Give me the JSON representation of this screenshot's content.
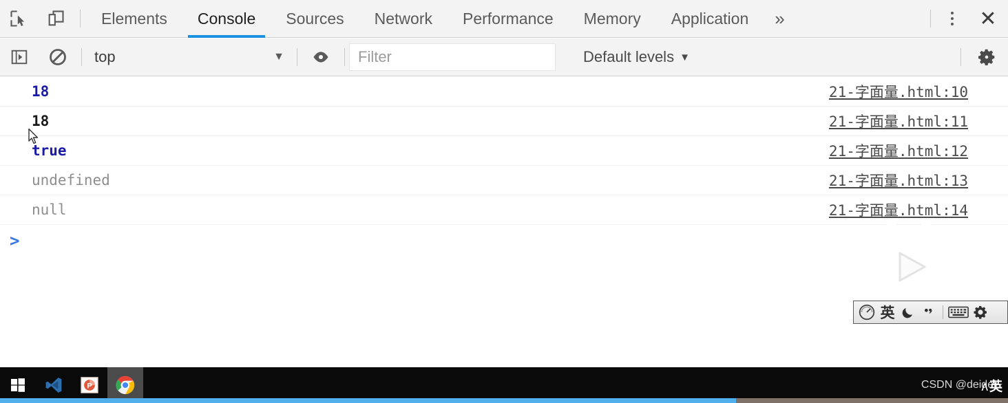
{
  "window": {
    "app": "Chrome DevTools"
  },
  "tabbar": {
    "icons": [
      {
        "name": "inspect-element-icon",
        "label": "Inspect element"
      },
      {
        "name": "device-toolbar-icon",
        "label": "Toggle device toolbar"
      }
    ],
    "tabs": [
      {
        "label": "Elements",
        "active": false
      },
      {
        "label": "Console",
        "active": true
      },
      {
        "label": "Sources",
        "active": false
      },
      {
        "label": "Network",
        "active": false
      },
      {
        "label": "Performance",
        "active": false
      },
      {
        "label": "Memory",
        "active": false
      },
      {
        "label": "Application",
        "active": false
      }
    ],
    "more_label": "»",
    "menu_label": "Customize and control DevTools",
    "close_label": "✕",
    "active_underline_color": "#1a90e0"
  },
  "filterbar": {
    "sidebar_toggle_label": "Show console sidebar",
    "clear_label": "Clear console",
    "context": "top",
    "context_caret": "▼",
    "eye_label": "Create live expression",
    "filter_value": "",
    "filter_placeholder": "Filter",
    "levels_label": "Default levels",
    "levels_caret": "▼",
    "settings_label": "Console settings"
  },
  "console": {
    "messages": [
      {
        "text": "18",
        "type": "number",
        "source": "21-字面量.html:10"
      },
      {
        "text": "18",
        "type": "string",
        "source": "21-字面量.html:11"
      },
      {
        "text": "true",
        "type": "boolean",
        "source": "21-字面量.html:12"
      },
      {
        "text": "undefined",
        "type": "undefined",
        "source": "21-字面量.html:13"
      },
      {
        "text": "null",
        "type": "null",
        "source": "21-字面量.html:14"
      }
    ],
    "prompt_caret": ">",
    "prompt_value": ""
  },
  "watermarks": {
    "bilibili_label": "bilibili-logo",
    "csdn_text": "CSDN @deidei~"
  },
  "ime": {
    "items": [
      {
        "name": "sogou-logo-icon",
        "glyph": ""
      },
      {
        "name": "language-mode",
        "glyph": "英"
      },
      {
        "name": "moon-icon",
        "glyph": "☾"
      },
      {
        "name": "punctuation-icon",
        "glyph": "•,"
      },
      {
        "name": "keyboard-icon",
        "glyph": ""
      },
      {
        "name": "settings-gear-icon",
        "glyph": ""
      }
    ],
    "tray_chevron": "ʌ",
    "tray_lang": "英"
  },
  "taskbar": {
    "items": [
      {
        "name": "start-button",
        "label": "Start",
        "active": false
      },
      {
        "name": "vscode-button",
        "label": "Visual Studio Code",
        "active": false
      },
      {
        "name": "powerpoint-button",
        "label": "PowerPoint",
        "active": false
      },
      {
        "name": "chrome-button",
        "label": "Google Chrome",
        "active": true
      }
    ]
  },
  "progress": {
    "percent": 73,
    "fill_color": "#4fb0ed",
    "track_color": "#7d7168"
  }
}
